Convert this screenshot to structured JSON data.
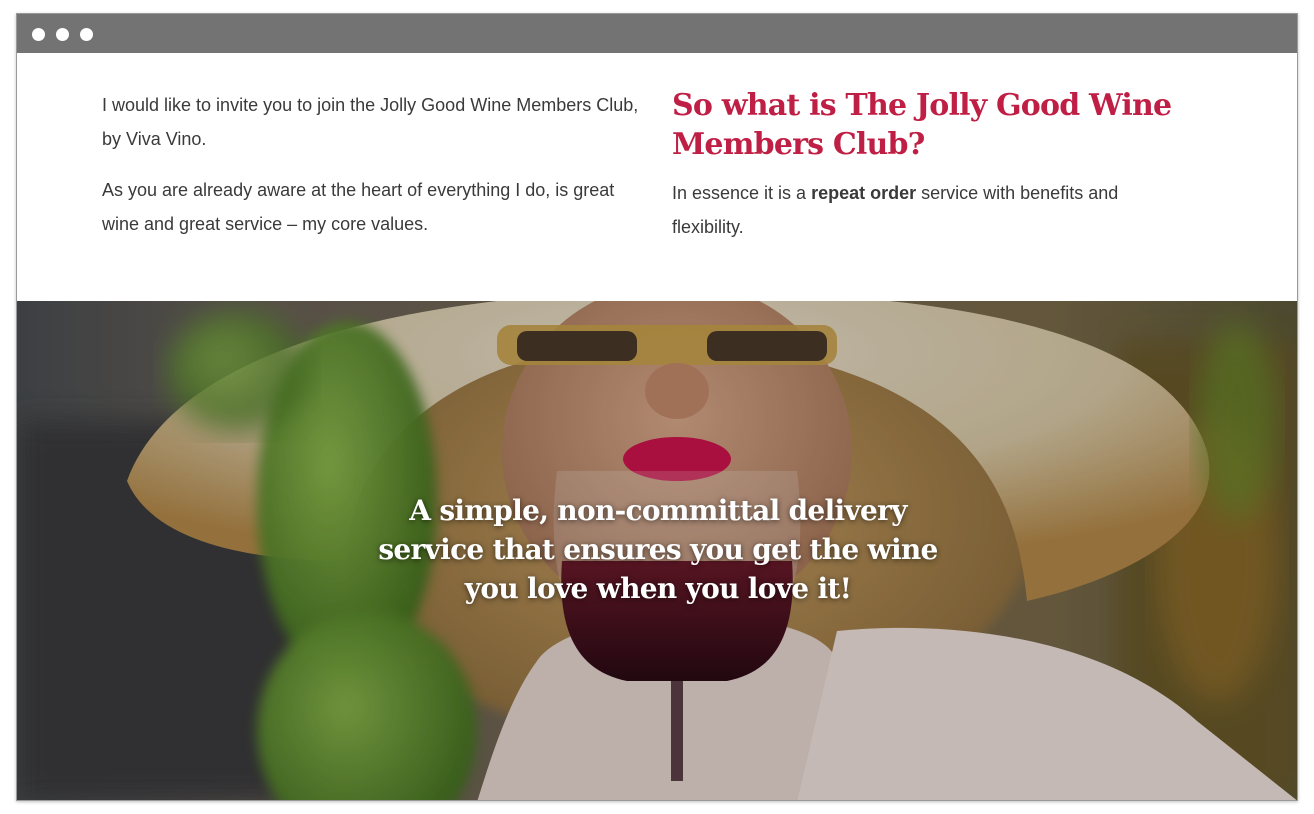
{
  "intro": {
    "paragraph_1": "I would like to invite you to join the Jolly Good Wine Members Club, by Viva Vino.",
    "paragraph_2": "As you are already aware at the heart of everything I do, is great wine and great service – my core values."
  },
  "club": {
    "heading": "So what is The Jolly Good Wine Members Club?",
    "description_before": "In essence it is a ",
    "description_bold": "repeat order",
    "description_after": " service with benefits and flexibility."
  },
  "hero": {
    "caption": "A simple, non-committal delivery service that ensures you get the wine you love when you love it!"
  },
  "colors": {
    "accent": "#c01f45",
    "body_text": "#3a3a3a",
    "browser_bar": "#737373"
  }
}
